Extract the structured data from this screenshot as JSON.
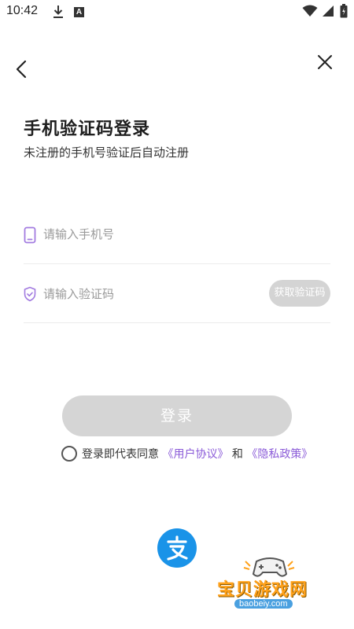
{
  "status_bar": {
    "time": "10:42",
    "icons": [
      "download-icon",
      "a-badge-icon",
      "wifi-icon",
      "signal-icon",
      "battery-icon"
    ]
  },
  "nav": {
    "back_icon": "chevron-left-icon",
    "close_icon": "close-icon"
  },
  "header": {
    "title": "手机验证码登录",
    "subtitle": "未注册的手机号验证后自动注册"
  },
  "form": {
    "phone": {
      "placeholder": "请输入手机号",
      "value": "",
      "icon": "phone-icon"
    },
    "code": {
      "placeholder": "请输入验证码",
      "value": "",
      "icon": "shield-check-icon",
      "get_code_label": "获取验证码"
    },
    "login_label": "登录"
  },
  "agreement": {
    "checked": false,
    "prefix": "登录即代表同意",
    "user_agreement": "《用户协议》",
    "conjunction": "和",
    "privacy_policy": "《隐私政策》"
  },
  "third_party": {
    "alipay_icon": "alipay-icon"
  },
  "watermark": {
    "text": "宝贝游戏网",
    "url": "baobeiy.com"
  },
  "colors": {
    "accent": "#8b5bd8",
    "disabled_button": "#d5d5d5",
    "alipay_blue": "#1a93e8",
    "watermark_orange": "#ffa11a"
  }
}
